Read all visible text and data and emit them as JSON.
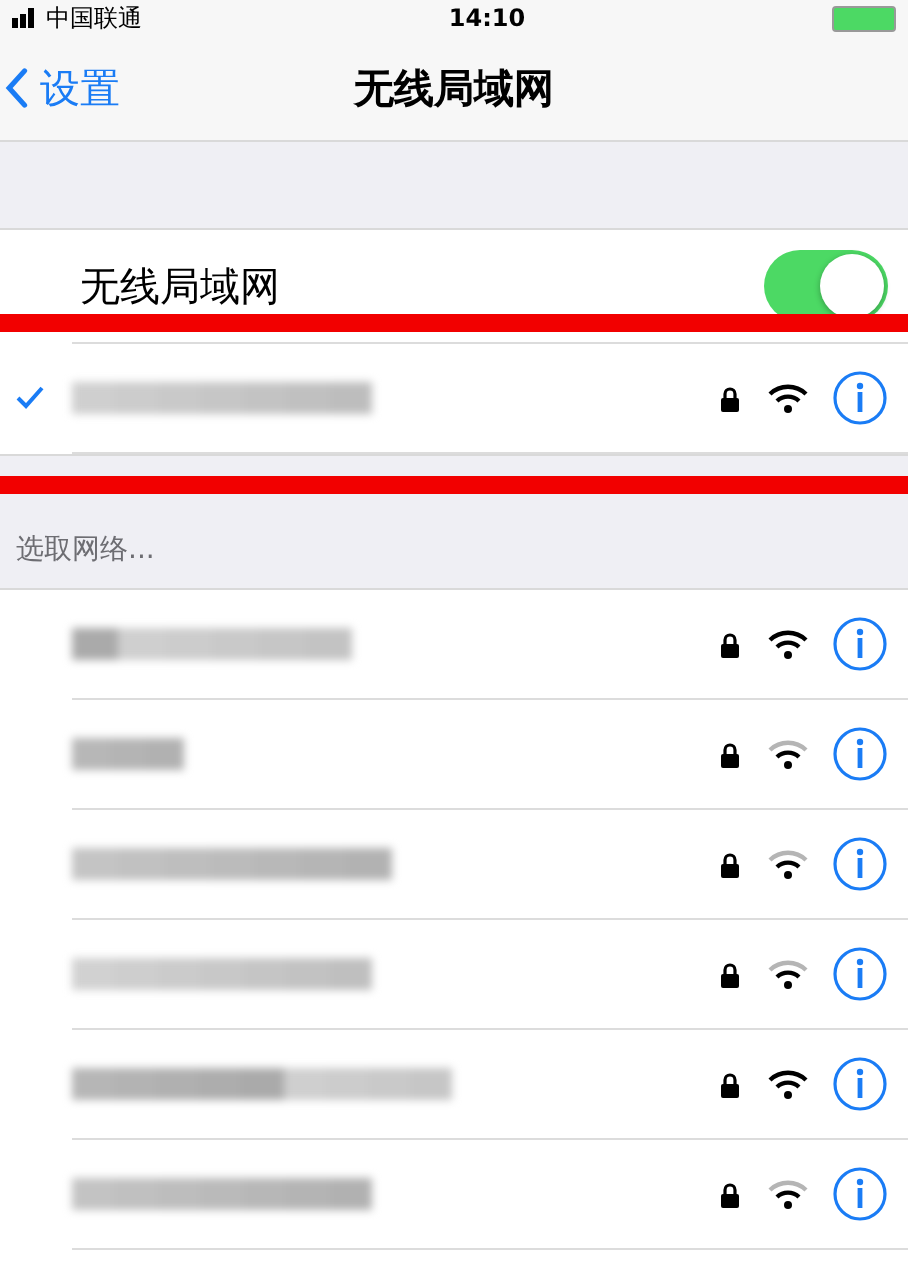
{
  "status_bar": {
    "carrier": "中国联通",
    "time": "14:10"
  },
  "nav": {
    "back": "设置",
    "title": "无线局域网"
  },
  "wifi_toggle": {
    "label": "无线局域网",
    "on": true
  },
  "current_network": {
    "connected": true,
    "locked": true,
    "full_signal": true
  },
  "section_header": "选取网络...",
  "networks": [
    {
      "locked": true,
      "full_signal": true
    },
    {
      "locked": true,
      "full_signal": false
    },
    {
      "locked": true,
      "full_signal": false
    },
    {
      "locked": true,
      "full_signal": false
    },
    {
      "locked": true,
      "full_signal": true
    },
    {
      "locked": true,
      "full_signal": false
    }
  ]
}
